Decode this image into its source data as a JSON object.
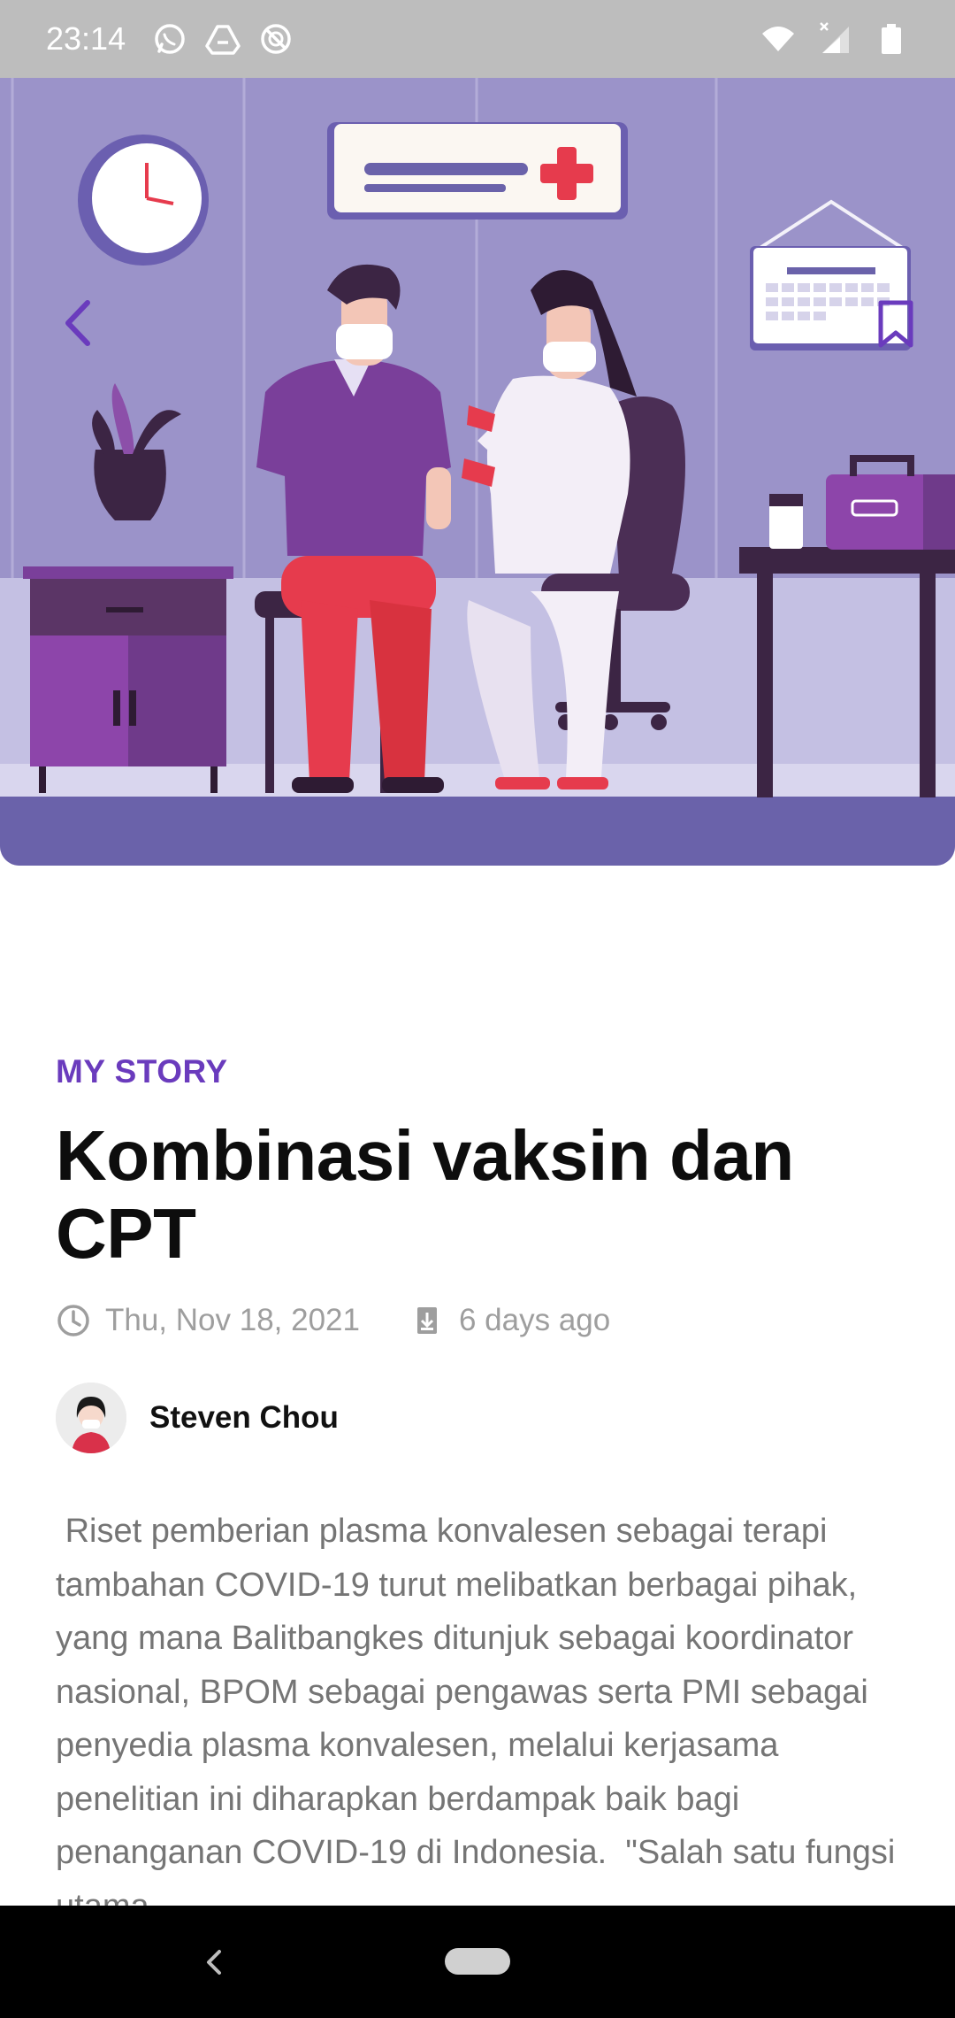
{
  "status_bar": {
    "time": "23:14",
    "left_icons": [
      "whatsapp-icon",
      "drive-icon",
      "data-saver-icon"
    ],
    "right_icons": [
      "wifi-icon",
      "cell-signal-icon",
      "battery-icon"
    ]
  },
  "hero": {
    "image_description_icon": "vaccination-illustration",
    "back_icon": "back-chevron-icon",
    "bookmark_icon": "bookmark-icon",
    "accent_color": "#6a3bbd"
  },
  "article": {
    "category": "MY STORY",
    "title": "Kombinasi vaksin dan CPT",
    "date": "Thu, Nov 18, 2021",
    "relative_time": "6 days ago",
    "author": "Steven Chou",
    "body": " Riset pemberian plasma konvalesen sebagai terapi tambahan COVID-19 turut melibatkan berbagai pihak, yang mana Balitbangkes ditunjuk sebagai koordinator nasional, BPOM sebagai pengawas serta PMI sebagai penyedia plasma konvalesen, melalui kerjasama penelitian ini diharapkan berdampak baik bagi penanganan COVID-19 di Indonesia.  \"Salah satu fungsi utama"
  },
  "nav_bar": {
    "back_icon": "nav-back-icon",
    "home_icon": "nav-home-pill"
  }
}
